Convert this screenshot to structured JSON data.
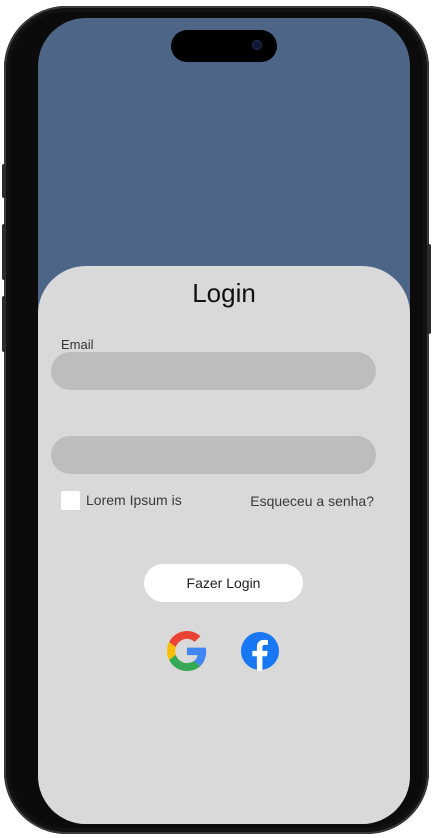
{
  "login": {
    "title": "Login",
    "email_label": "Email",
    "email_value": "",
    "password_value": "",
    "remember_label": "Lorem Ipsum is",
    "remember_checked": false,
    "forgot_label": "Esqueceu a senha?",
    "submit_label": "Fazer Login"
  },
  "social": {
    "google_icon": "google-icon",
    "facebook_icon": "facebook-icon"
  },
  "colors": {
    "header_bg": "#4d6688",
    "sheet_bg": "#d9d9d9",
    "field_bg": "#bdbdbd",
    "button_bg": "#ffffff",
    "facebook_blue": "#1877f2"
  }
}
